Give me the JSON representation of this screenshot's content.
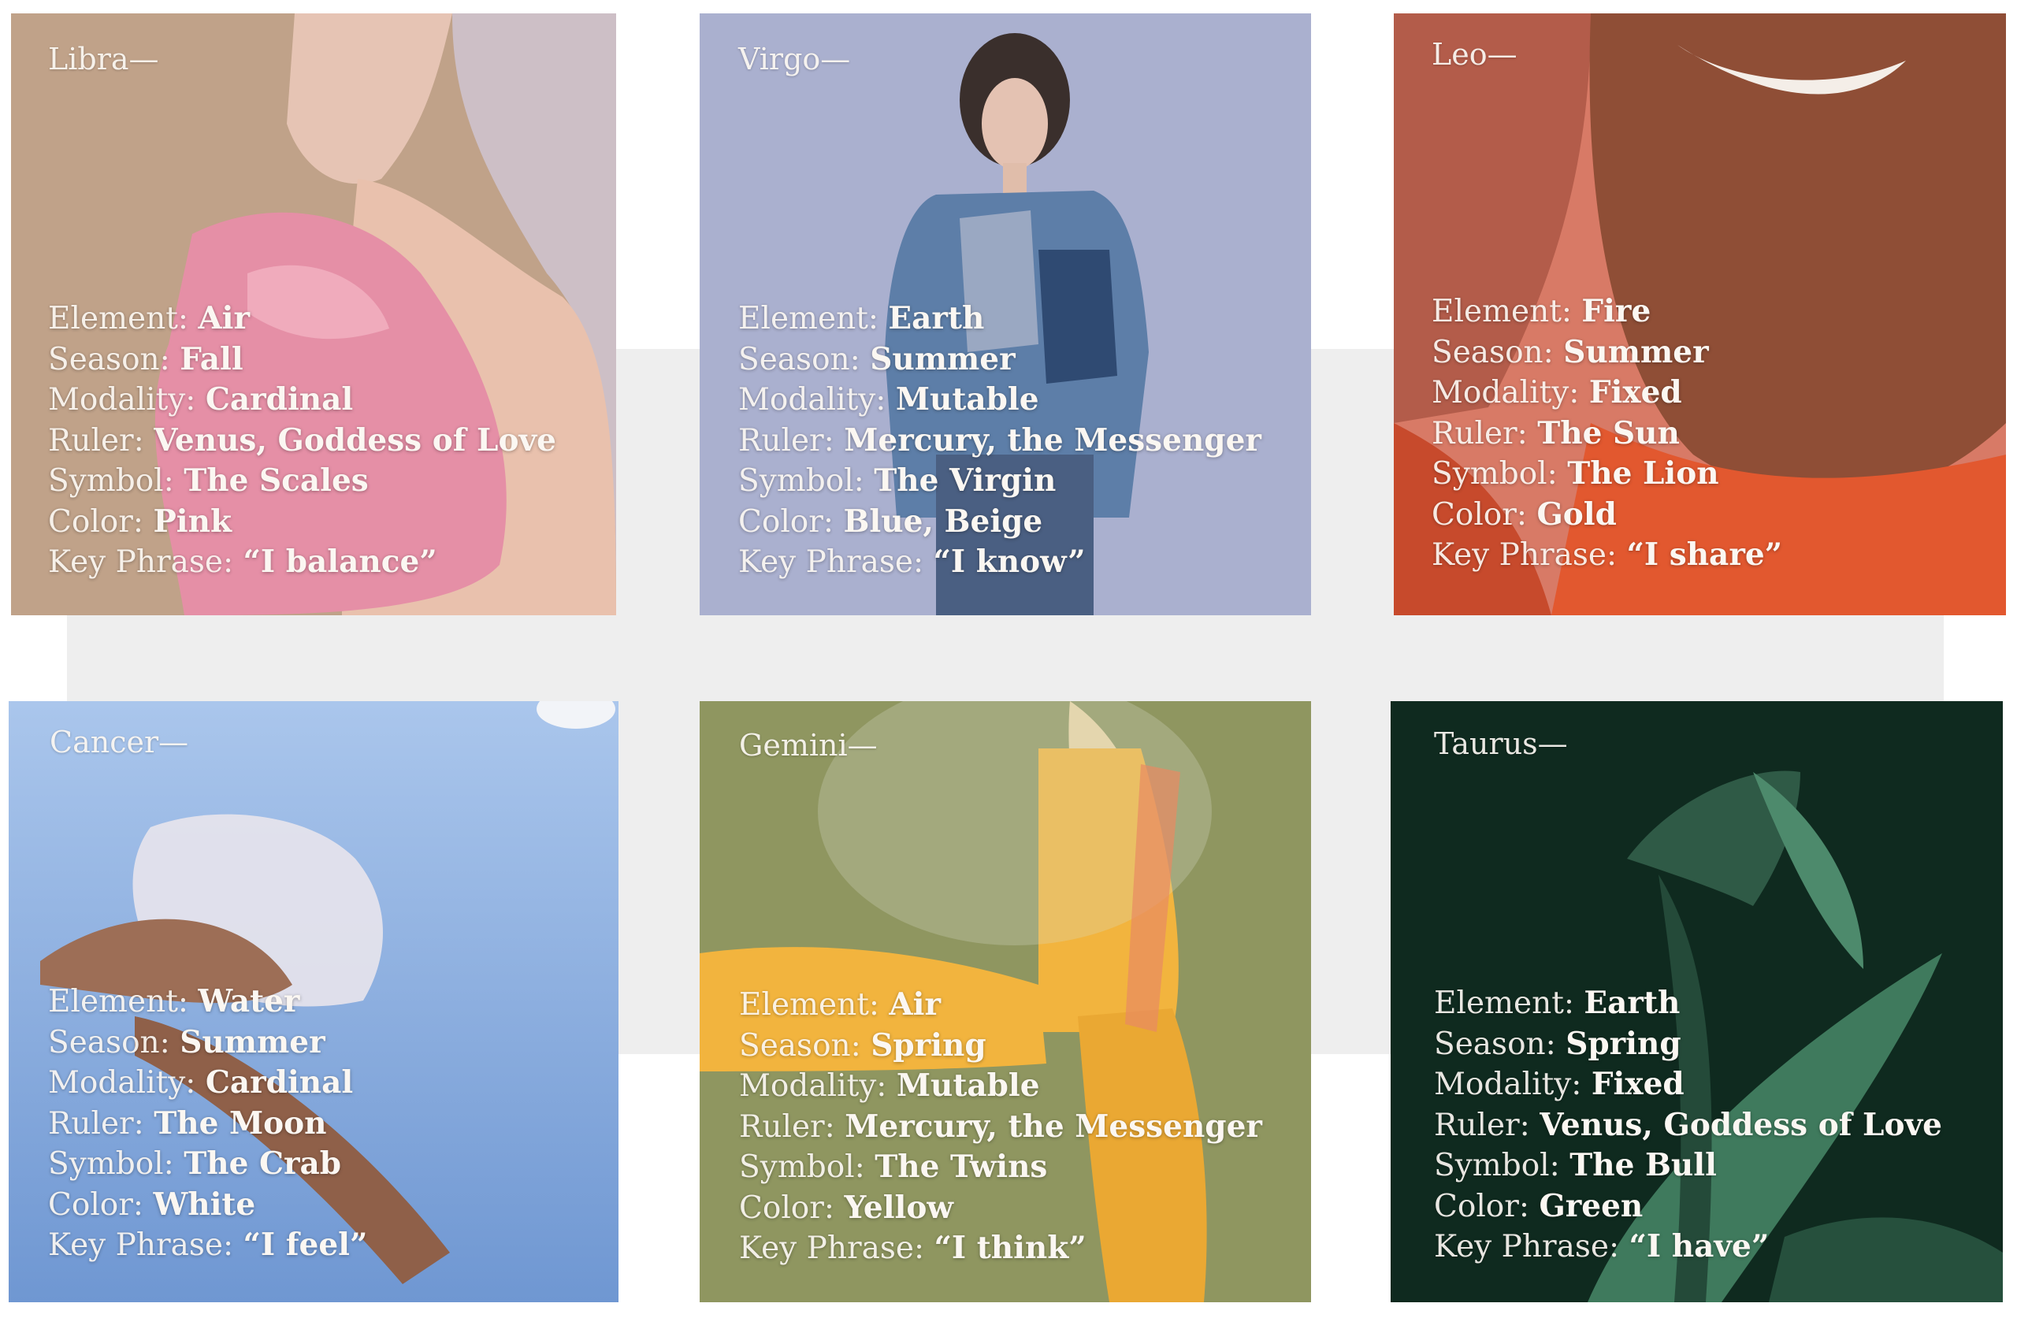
{
  "cards": [
    {
      "sign": "Libra—",
      "labels": [
        "Element: ",
        "Season: ",
        "Modality: ",
        "Ruler: ",
        "Symbol: ",
        "Color: ",
        "Key Phrase: "
      ],
      "values": [
        "Air",
        "Fall",
        "Cardinal",
        "Venus, Goddess of Love",
        "The Scales",
        "Pink",
        "“I balance”"
      ],
      "colors": {
        "base": "#cdbfc6",
        "accent": "#e58fa6",
        "hair": "#c49a62"
      }
    },
    {
      "sign": "Virgo—",
      "labels": [
        "Element: ",
        "Season: ",
        "Modality: ",
        "Ruler: ",
        "Symbol: ",
        "Color: ",
        "Key Phrase: "
      ],
      "values": [
        "Earth",
        "Summer",
        "Mutable",
        "Mercury, the Messenger",
        "The Virgin",
        "Blue, Beige",
        "“I know”"
      ],
      "colors": {
        "base": "#aab0cf",
        "accent": "#3e5a84",
        "hair": "#3a2f2c"
      }
    },
    {
      "sign": "Leo—",
      "labels": [
        "Element: ",
        "Season: ",
        "Modality: ",
        "Ruler: ",
        "Symbol: ",
        "Color: ",
        "Key Phrase: "
      ],
      "values": [
        "Fire",
        "Summer",
        "Fixed",
        "The Sun",
        "The Lion",
        "Gold",
        "“I share”"
      ],
      "colors": {
        "base": "#d87a66",
        "accent": "#e2582f",
        "hair": "#8a4a35"
      }
    },
    {
      "sign": "Cancer—",
      "labels": [
        "Element: ",
        "Season: ",
        "Modality: ",
        "Ruler: ",
        "Symbol: ",
        "Color: ",
        "Key Phrase: "
      ],
      "values": [
        "Water",
        "Summer",
        "Cardinal",
        "The Moon",
        "The Crab",
        "White",
        "“I feel”"
      ],
      "colors": {
        "base": "#8fb2e0",
        "accent": "#e8e4ec",
        "hair": "#9d6e56"
      }
    },
    {
      "sign": "Gemini—",
      "labels": [
        "Element: ",
        "Season: ",
        "Modality: ",
        "Ruler: ",
        "Symbol: ",
        "Color: ",
        "Key Phrase: "
      ],
      "values": [
        "Air",
        "Spring",
        "Mutable",
        "Mercury, the Messenger",
        "The Twins",
        "Yellow",
        "“I think”"
      ],
      "colors": {
        "base": "#8f9660",
        "accent": "#f2b43e",
        "hair": "#e9d5a4"
      }
    },
    {
      "sign": "Taurus—",
      "labels": [
        "Element: ",
        "Season: ",
        "Modality: ",
        "Ruler: ",
        "Symbol: ",
        "Color: ",
        "Key Phrase: "
      ],
      "values": [
        "Earth",
        "Spring",
        "Fixed",
        "Venus, Goddess of Love",
        "The Bull",
        "Green",
        "“I have”"
      ],
      "colors": {
        "base": "#0f2a1f",
        "accent": "#4d8a6c",
        "hair": "#1e4434"
      }
    }
  ]
}
